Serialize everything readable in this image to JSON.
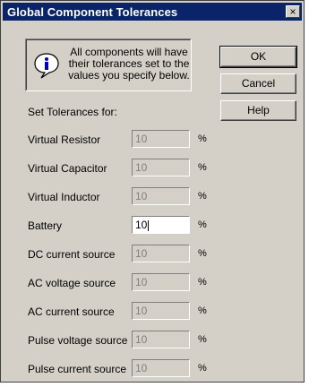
{
  "window": {
    "title": "Global Component Tolerances",
    "close_glyph": "×"
  },
  "info": {
    "icon": "info-icon",
    "text": "All components will have their tolerances set to the values you specify below."
  },
  "buttons": {
    "ok": "OK",
    "cancel": "Cancel",
    "help": "Help"
  },
  "section_label": "Set Tolerances for:",
  "rows": [
    {
      "label": "Virtual Resistor",
      "value": "10",
      "unit": "%"
    },
    {
      "label": "Virtual Capacitor",
      "value": "10",
      "unit": "%"
    },
    {
      "label": "Virtual Inductor",
      "value": "10",
      "unit": "%"
    },
    {
      "label": "Battery",
      "value": "10",
      "unit": "%"
    },
    {
      "label": "DC current source",
      "value": "10",
      "unit": "%"
    },
    {
      "label": "AC voltage source",
      "value": "10",
      "unit": "%"
    },
    {
      "label": "AC current source",
      "value": "10",
      "unit": "%"
    },
    {
      "label": "Pulse voltage source",
      "value": "10",
      "unit": "%"
    },
    {
      "label": "Pulse current source",
      "value": "10",
      "unit": "%"
    }
  ],
  "colors": {
    "title_bar": "#0a246a",
    "dialog_face": "#d4d0c8",
    "disabled_text": "#808080"
  }
}
